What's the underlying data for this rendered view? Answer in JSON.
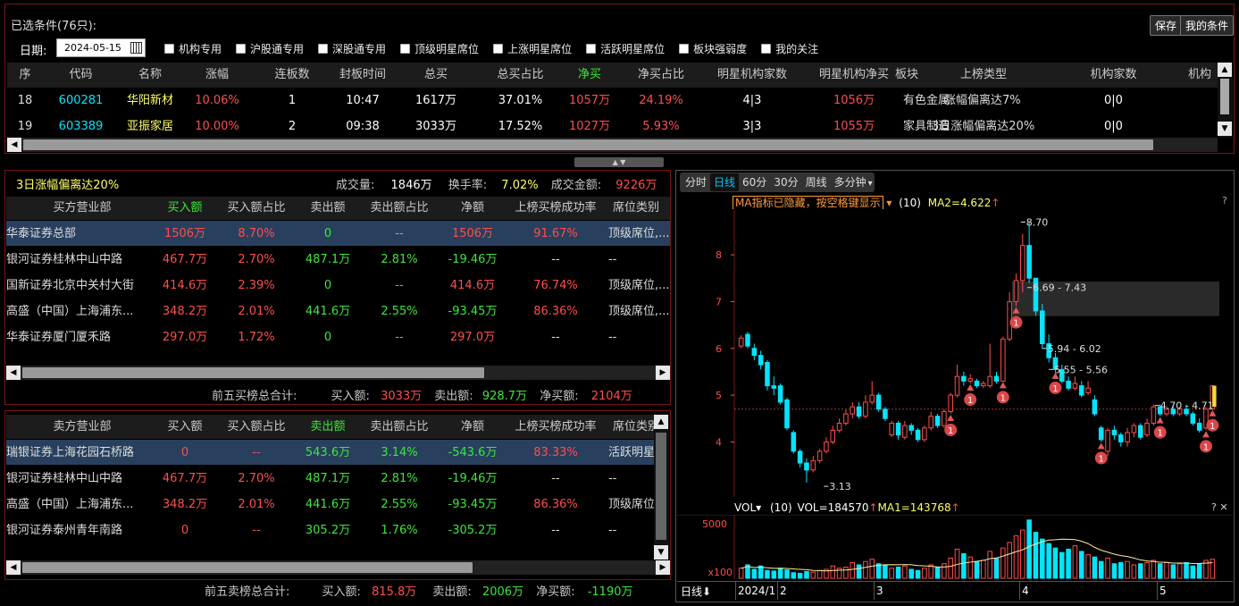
{
  "title": "已选条件(76只):",
  "buttons": {
    "save": "保存",
    "my_conditions": "我的条件"
  },
  "date": {
    "label": "日期:",
    "value": "2024-05-15"
  },
  "filters": [
    "机构专用",
    "沪股通专用",
    "深股通专用",
    "顶级明星席位",
    "上涨明星席位",
    "活跃明星席位",
    "板块强弱度",
    "我的关注"
  ],
  "top_table": {
    "columns": [
      "序",
      "代码",
      "名称",
      "涨幅",
      "连板数",
      "封板时间",
      "总买",
      "总买占比",
      "净买",
      "净买占比",
      "明星机构家数",
      "明星机构净买",
      "板块",
      "上榜类型",
      "机构家数",
      "机构"
    ],
    "rows": [
      [
        "18",
        "600281",
        "华阳新材",
        "10.06%",
        "1",
        "10:47",
        "1617万",
        "37.01%",
        "1057万",
        "24.19%",
        "4|3",
        "1056万",
        "有色金属",
        "涨幅偏离达7%",
        "0|0"
      ],
      [
        "19",
        "603389",
        "亚振家居",
        "10.00%",
        "2",
        "09:38",
        "3033万",
        "17.52%",
        "1027万",
        "5.93%",
        "3|3",
        "1055万",
        "家具制造",
        "3日涨幅偏离达20%",
        "0|0"
      ]
    ]
  },
  "summary": {
    "type": "3日涨幅偏离达20%",
    "volume_label": "成交量:",
    "volume": "1846万",
    "turnover_label": "换手率:",
    "turnover": "7.02%",
    "amount_label": "成交金额:",
    "amount": "9226万"
  },
  "buy_table": {
    "columns": [
      "买方营业部",
      "买入额",
      "买入额占比",
      "卖出额",
      "卖出额占比",
      "净额",
      "上榜买榜成功率",
      "席位类别"
    ],
    "rows": [
      [
        "华泰证券总部",
        "1506万",
        "8.70%",
        "0",
        "--",
        "1506万",
        "91.67%",
        "顶级席位,..."
      ],
      [
        "银河证券桂林中山中路",
        "467.7万",
        "2.70%",
        "487.1万",
        "2.81%",
        "-19.46万",
        "--",
        "--"
      ],
      [
        "国新证券北京中关村大街",
        "414.6万",
        "2.39%",
        "0",
        "--",
        "414.6万",
        "76.74%",
        "顶级席位,..."
      ],
      [
        "高盛（中国）上海浦东...",
        "348.2万",
        "2.01%",
        "441.6万",
        "2.55%",
        "-93.45万",
        "86.36%",
        "顶级席位,..."
      ],
      [
        "华泰证券厦门厦禾路",
        "297.0万",
        "1.72%",
        "0",
        "--",
        "297.0万",
        "--",
        "--"
      ]
    ],
    "total_label": "前五买榜总合计:",
    "buy_label": "买入额:",
    "buy": "3033万",
    "sell_label": "卖出额:",
    "sell": "928.7万",
    "net_label": "净买额:",
    "net": "2104万"
  },
  "sell_table": {
    "columns": [
      "卖方营业部",
      "买入额",
      "买入额占比",
      "卖出额",
      "卖出额占比",
      "净额",
      "上榜买榜成功率",
      "席位类别"
    ],
    "rows": [
      [
        "瑞银证券上海花园石桥路",
        "0",
        "--",
        "543.6万",
        "3.14%",
        "-543.6万",
        "83.33%",
        "活跃明星"
      ],
      [
        "银河证券桂林中山中路",
        "467.7万",
        "2.70%",
        "487.1万",
        "2.81%",
        "-19.46万",
        "--",
        "--"
      ],
      [
        "高盛（中国）上海浦东...",
        "348.2万",
        "2.01%",
        "441.6万",
        "2.55%",
        "-93.45万",
        "86.36%",
        "顶级席位"
      ],
      [
        "银河证券泰州青年南路",
        "0",
        "--",
        "305.2万",
        "1.76%",
        "-305.2万",
        "--",
        "--"
      ]
    ],
    "total_label": "前五卖榜总合计:",
    "buy_label": "买入额:",
    "buy": "815.8万",
    "sell_label": "卖出额:",
    "sell": "2006万",
    "net_label": "净买额:",
    "net": "-1190万"
  },
  "chart_tabs": [
    "分时",
    "日线",
    "60分",
    "30分",
    "周线",
    "多分钟"
  ],
  "chart_tab_active": "日线",
  "ma_bar": {
    "button": "MA指标已隐藏，按空格键显示",
    "period": "(10)",
    "ma2": "MA2=4.622"
  },
  "vol_bar": {
    "button": "VOL",
    "period": "(10)",
    "vol": "VOL=184570",
    "ma1": "MA1=143768"
  },
  "footer": {
    "period": "日线",
    "dates": [
      "2024/1",
      "2",
      "3",
      "4",
      "5"
    ]
  },
  "colors": {
    "up": "#ff4d4d",
    "down": "#00e5ff",
    "accent_yellow": "#ffff66",
    "border": "#7a1414"
  },
  "chart_data": {
    "type": "candlestick",
    "yticks": [
      4,
      5,
      6,
      7,
      8
    ],
    "ylim": [
      2.9,
      8.9
    ],
    "price_labels": [
      "8.70",
      "6.69 - 7.43",
      "5.94 - 6.02",
      "5.55 - 5.56",
      "4.70 - 4.71",
      "3.13"
    ],
    "marker_label": "1",
    "candles": [
      [
        6.05,
        6.22,
        6.28,
        6.0
      ],
      [
        6.3,
        6.05,
        6.35,
        6.0
      ],
      [
        6.0,
        5.85,
        6.1,
        5.75
      ],
      [
        5.85,
        5.65,
        5.95,
        5.55
      ],
      [
        5.7,
        5.2,
        5.75,
        5.1
      ],
      [
        5.2,
        5.15,
        5.4,
        5.0
      ],
      [
        5.2,
        4.85,
        5.25,
        4.8
      ],
      [
        4.9,
        4.3,
        4.95,
        4.25
      ],
      [
        4.2,
        3.8,
        4.25,
        3.75
      ],
      [
        3.8,
        3.55,
        3.85,
        3.45
      ],
      [
        3.55,
        3.4,
        3.65,
        3.13
      ],
      [
        3.4,
        3.6,
        3.7,
        3.35
      ],
      [
        3.6,
        3.8,
        3.85,
        3.55
      ],
      [
        3.8,
        4.0,
        4.1,
        3.75
      ],
      [
        4.0,
        4.25,
        4.35,
        3.95
      ],
      [
        4.25,
        4.4,
        4.5,
        4.2
      ],
      [
        4.4,
        4.6,
        4.7,
        4.35
      ],
      [
        4.6,
        4.75,
        4.85,
        4.5
      ],
      [
        4.75,
        4.55,
        4.85,
        4.5
      ],
      [
        4.55,
        4.85,
        5.0,
        4.5
      ],
      [
        4.85,
        5.0,
        5.3,
        4.8
      ],
      [
        5.0,
        4.7,
        5.05,
        4.65
      ],
      [
        4.7,
        4.5,
        4.75,
        4.45
      ],
      [
        4.15,
        4.4,
        4.45,
        4.1
      ],
      [
        4.4,
        4.15,
        4.45,
        4.05
      ],
      [
        4.1,
        4.35,
        4.45,
        4.05
      ],
      [
        4.35,
        4.25,
        4.4,
        4.15
      ],
      [
        4.25,
        4.05,
        4.3,
        4.0
      ],
      [
        4.05,
        4.3,
        4.35,
        4.0
      ],
      [
        4.3,
        4.55,
        4.65,
        4.25
      ],
      [
        4.55,
        4.35,
        4.6,
        4.3
      ],
      [
        4.35,
        4.65,
        4.7,
        4.3
      ],
      [
        4.65,
        5.0,
        5.05,
        4.6
      ],
      [
        5.0,
        5.4,
        5.65,
        4.95
      ],
      [
        5.4,
        5.3,
        5.5,
        5.2
      ],
      [
        5.3,
        5.35,
        5.45,
        5.25
      ],
      [
        5.3,
        5.2,
        5.35,
        5.15
      ],
      [
        5.2,
        5.25,
        5.3,
        5.15
      ],
      [
        5.2,
        5.4,
        6.1,
        5.15
      ],
      [
        5.4,
        5.3,
        5.5,
        5.25
      ],
      [
        5.3,
        6.2,
        6.25,
        5.3
      ],
      [
        6.2,
        7.0,
        7.2,
        6.15
      ],
      [
        7.0,
        7.45,
        7.6,
        6.9
      ],
      [
        7.45,
        8.2,
        8.45,
        7.2
      ],
      [
        8.2,
        7.5,
        8.7,
        7.4
      ],
      [
        7.5,
        6.8,
        7.5,
        6.7
      ],
      [
        6.8,
        6.1,
        6.95,
        6.0
      ],
      [
        6.1,
        5.8,
        6.3,
        5.7
      ],
      [
        5.8,
        5.55,
        5.9,
        5.5
      ],
      [
        5.55,
        5.3,
        5.65,
        5.25
      ],
      [
        5.3,
        5.15,
        5.4,
        5.1
      ],
      [
        5.15,
        5.25,
        5.4,
        5.1
      ],
      [
        5.2,
        5.0,
        5.3,
        4.95
      ],
      [
        5.05,
        5.15,
        5.3,
        5.0
      ],
      [
        4.9,
        4.6,
        5.0,
        4.55
      ],
      [
        4.3,
        4.05,
        4.35,
        4.0
      ],
      [
        3.8,
        4.25,
        4.3,
        3.7
      ],
      [
        4.25,
        4.15,
        4.35,
        4.05
      ],
      [
        4.15,
        4.0,
        4.2,
        3.9
      ],
      [
        4.0,
        4.2,
        4.3,
        3.9
      ],
      [
        4.2,
        4.35,
        4.4,
        4.1
      ],
      [
        4.35,
        4.1,
        4.4,
        4.05
      ],
      [
        4.15,
        4.4,
        4.5,
        4.1
      ],
      [
        4.4,
        4.75,
        4.8,
        4.35
      ],
      [
        4.75,
        4.6,
        4.8,
        4.55
      ],
      [
        4.6,
        4.7,
        4.75,
        4.55
      ],
      [
        4.7,
        4.6,
        4.75,
        4.55
      ],
      [
        4.6,
        4.7,
        4.75,
        4.55
      ],
      [
        4.7,
        4.6,
        4.8,
        4.55
      ],
      [
        4.6,
        4.4,
        4.65,
        4.35
      ],
      [
        4.4,
        4.25,
        4.5,
        4.2
      ],
      [
        4.3,
        4.7,
        4.75,
        4.25
      ],
      [
        4.7,
        5.2,
        5.2,
        4.7
      ]
    ],
    "markers": [
      32,
      35,
      40,
      42,
      48,
      55,
      64,
      71,
      73
    ],
    "volumes": [
      900,
      1200,
      800,
      1100,
      700,
      650,
      900,
      750,
      500,
      450,
      600,
      550,
      700,
      800,
      1100,
      900,
      1000,
      1400,
      1200,
      1500,
      1700,
      1300,
      1200,
      900,
      1000,
      1100,
      800,
      700,
      900,
      1200,
      1000,
      1300,
      1800,
      2600,
      2200,
      1900,
      1500,
      1600,
      2400,
      1800,
      2700,
      3200,
      3800,
      4300,
      5200,
      4100,
      3500,
      3100,
      2700,
      2300,
      2600,
      2900,
      2400,
      2100,
      1900,
      1500,
      1800,
      1300,
      1400,
      1500,
      1200,
      1300,
      1400,
      1600,
      1300,
      1400,
      1200,
      1300,
      1400,
      1100,
      1300,
      1600,
      1700
    ],
    "vol_ytick": "5000",
    "vol_ylabel": "x100"
  }
}
